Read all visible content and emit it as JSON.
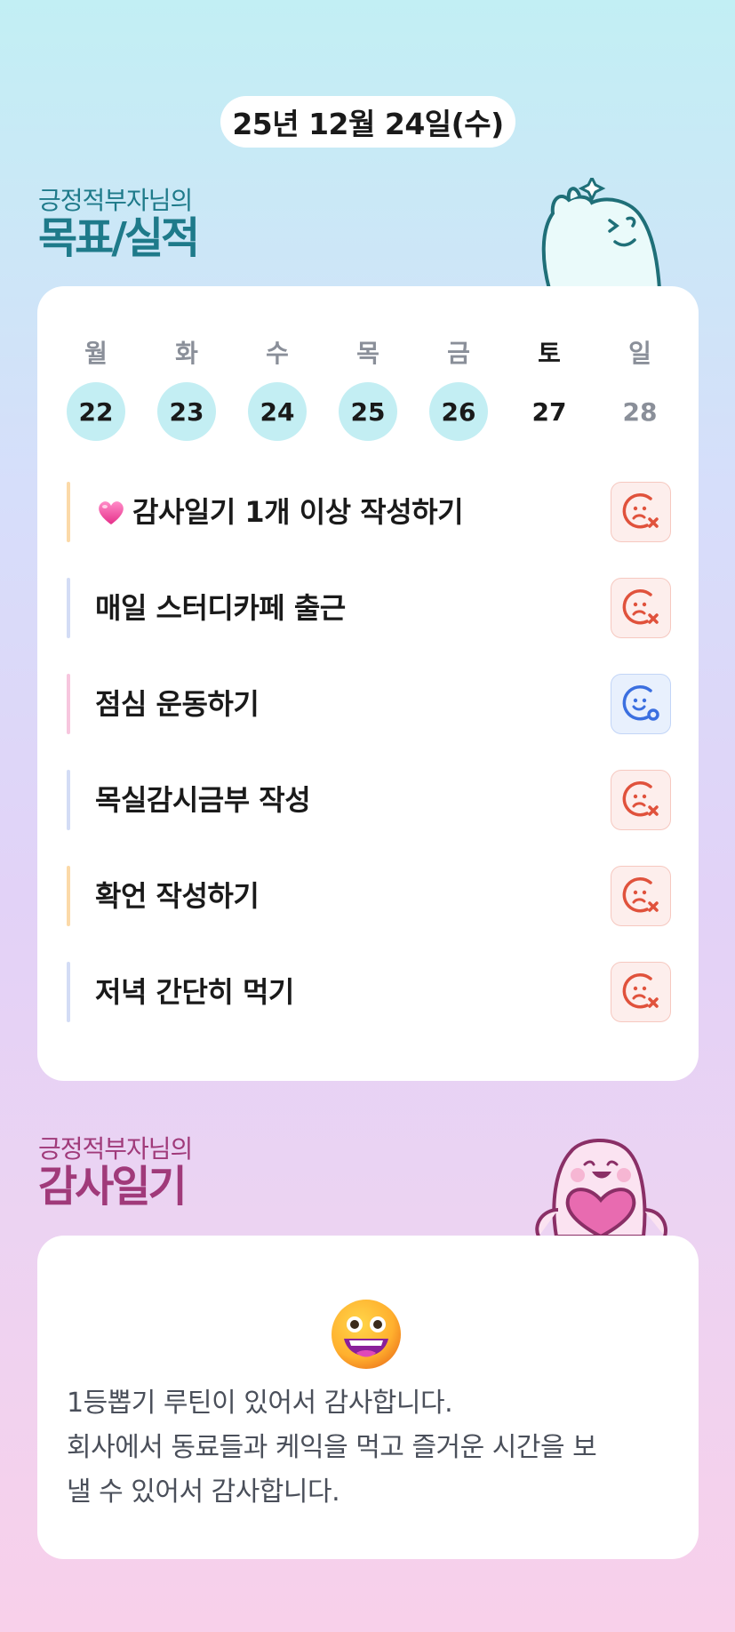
{
  "header": {
    "date": "25년 12월 24일(수)"
  },
  "goals_section": {
    "subtitle": "긍정적부자님의",
    "title": "목표/실적"
  },
  "week": [
    {
      "day": "월",
      "date": "22",
      "state": "done"
    },
    {
      "day": "화",
      "date": "23",
      "state": "done"
    },
    {
      "day": "수",
      "date": "24",
      "state": "done"
    },
    {
      "day": "목",
      "date": "25",
      "state": "done"
    },
    {
      "day": "금",
      "date": "26",
      "state": "done"
    },
    {
      "day": "토",
      "date": "27",
      "state": "plain"
    },
    {
      "day": "일",
      "date": "28",
      "state": "grey"
    }
  ],
  "goals": [
    {
      "label": "감사일기 1개 이상 작성하기",
      "icon": "heart-icon",
      "bar_color": "#fbd9a8",
      "status": "fail"
    },
    {
      "label": "매일 스터디카페 출근",
      "bar_color": "#d3dcf5",
      "status": "fail"
    },
    {
      "label": "점심 운동하기",
      "bar_color": "#f7c6de",
      "status": "ok"
    },
    {
      "label": "목실감시금부 작성",
      "bar_color": "#d3dcf5",
      "status": "fail"
    },
    {
      "label": "확언 작성하기",
      "bar_color": "#fbd9a8",
      "status": "fail"
    },
    {
      "label": "저녁 간단히 먹기",
      "bar_color": "#d3dcf5",
      "status": "fail"
    }
  ],
  "diary_section": {
    "subtitle": "긍정적부자님의",
    "title": "감사일기"
  },
  "diary": {
    "emoji": "grinning-face-icon",
    "text": "1등뽑기 루틴이 있어서 감사합니다.\n회사에서 동료들과 케익을 먹고 즐거운 시간을 보\n낼 수 있어서 감사합니다."
  },
  "colors": {
    "fail": "#e0523c",
    "ok": "#3b6fe0",
    "accent": "#c3eef3"
  }
}
